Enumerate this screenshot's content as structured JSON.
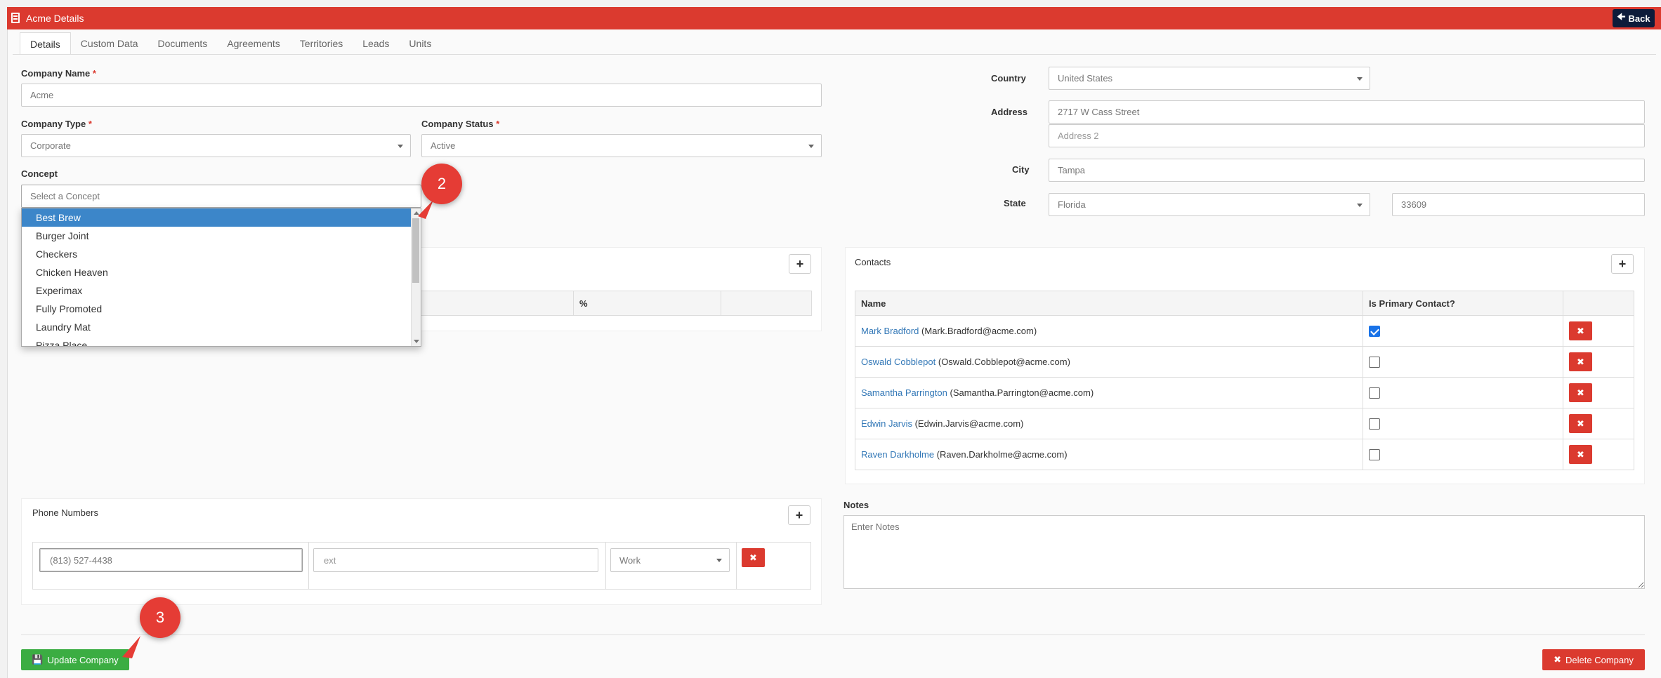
{
  "window": {
    "title": "Acme Details",
    "back_label": "Back"
  },
  "tabs": [
    "Details",
    "Custom Data",
    "Documents",
    "Agreements",
    "Territories",
    "Leads",
    "Units"
  ],
  "form": {
    "company_name": {
      "label": "Company Name",
      "value": "Acme"
    },
    "company_type": {
      "label": "Company Type",
      "value": "Corporate"
    },
    "company_status": {
      "label": "Company Status",
      "value": "Active"
    },
    "concept": {
      "label": "Concept",
      "placeholder": "Select a Concept"
    },
    "country": {
      "label": "Country",
      "value": "United States"
    },
    "address": {
      "label": "Address",
      "line1": "2717 W Cass Street",
      "line2_placeholder": "Address 2"
    },
    "city": {
      "label": "City",
      "value": "Tampa"
    },
    "state": {
      "label": "State",
      "value": "Florida",
      "zip": "33609"
    }
  },
  "concept_dropdown": {
    "options": [
      "Best Brew",
      "Burger Joint",
      "Checkers",
      "Chicken Heaven",
      "Experimax",
      "Fully Promoted",
      "Laundry Mat",
      "Pizza Place"
    ],
    "highlighted": "Best Brew"
  },
  "ownership_table": {
    "percent_header": "%"
  },
  "contacts": {
    "title": "Contacts",
    "headers": {
      "name": "Name",
      "primary": "Is Primary Contact?"
    },
    "rows": [
      {
        "name": "Mark Bradford",
        "email": "(Mark.Bradford@acme.com)",
        "primary": true
      },
      {
        "name": "Oswald Cobblepot",
        "email": "(Oswald.Cobblepot@acme.com)",
        "primary": false
      },
      {
        "name": "Samantha Parrington",
        "email": "(Samantha.Parrington@acme.com)",
        "primary": false
      },
      {
        "name": "Edwin Jarvis",
        "email": "(Edwin.Jarvis@acme.com)",
        "primary": false
      },
      {
        "name": "Raven Darkholme",
        "email": "(Raven.Darkholme@acme.com)",
        "primary": false
      }
    ]
  },
  "phone_numbers": {
    "title": "Phone Numbers",
    "number": "(813) 527-4438",
    "ext_placeholder": "ext",
    "type": "Work"
  },
  "notes": {
    "label": "Notes",
    "placeholder": "Enter Notes"
  },
  "actions": {
    "update_label": "Update Company",
    "delete_label": "Delete Company"
  },
  "callouts": {
    "c2": "2",
    "c3": "3"
  },
  "colors": {
    "header_red": "#db3a2f",
    "back_navy": "#0d1b3a",
    "update_green": "#3bad42",
    "link_blue": "#3378b7",
    "highlight_blue": "#3c86c9"
  }
}
